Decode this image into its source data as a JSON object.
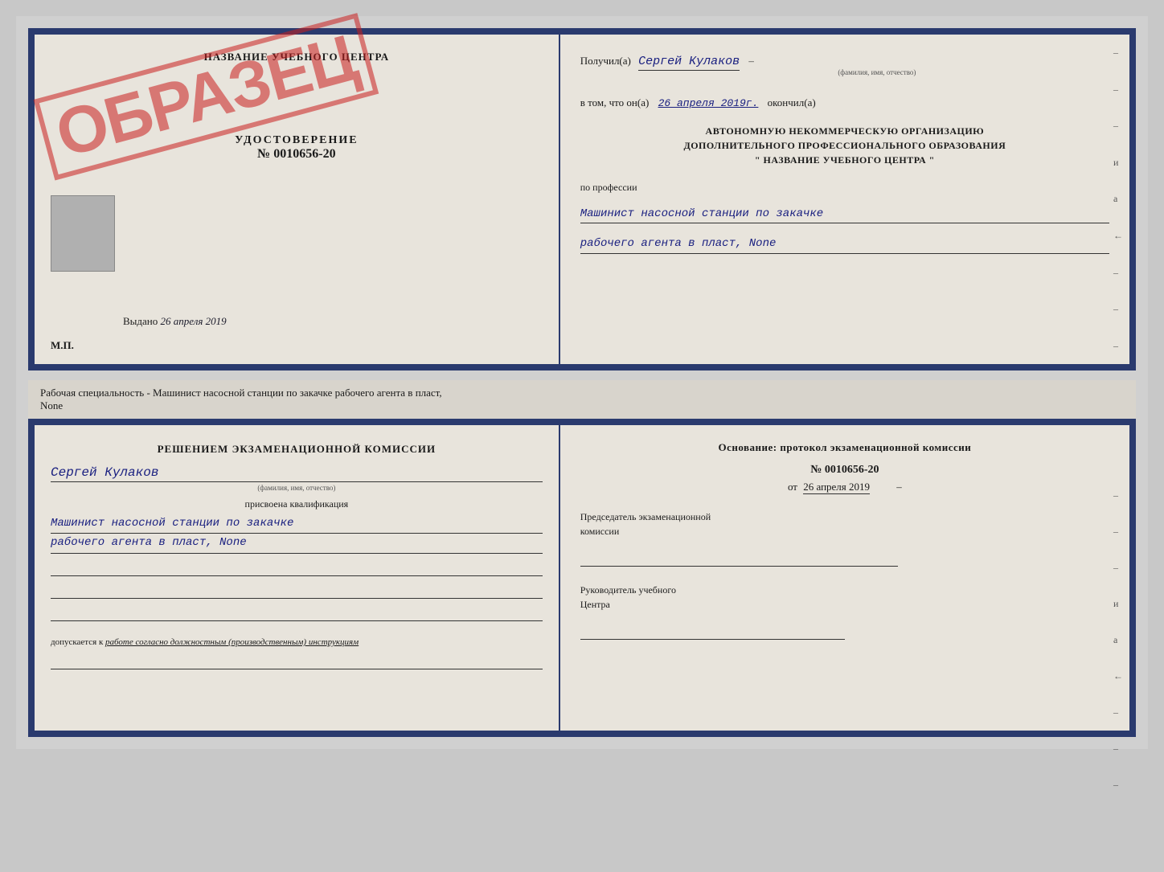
{
  "page": {
    "background": "#c8c8c8"
  },
  "top_doc": {
    "left": {
      "title": "НАЗВАНИЕ УЧЕБНОГО ЦЕНТРА",
      "stamp": "ОБРАЗЕЦ",
      "udostoverenie_label": "УДОСТОВЕРЕНИЕ",
      "number": "№ 0010656-20",
      "vydano_label": "Выдано",
      "vydano_date": "26 апреля 2019",
      "mp_label": "М.П."
    },
    "right": {
      "poluchil_prefix": "Получил(а)",
      "recipient_name": "Сергей Кулаков",
      "fio_hint": "(фамилия, имя, отчество)",
      "vtom_prefix": "в том, что он(а)",
      "date_value": "26 апреля 2019г.",
      "okonchil": "окончил(а)",
      "org_line1": "АВТОНОМНУЮ НЕКОММЕРЧЕСКУЮ ОРГАНИЗАЦИЮ",
      "org_line2": "ДОПОЛНИТЕЛЬНОГО ПРОФЕССИОНАЛЬНОГО ОБРАЗОВАНИЯ",
      "org_line3": "\"  НАЗВАНИЕ УЧЕБНОГО ЦЕНТРА  \"",
      "po_professii": "по профессии",
      "profession_line1": "Машинист насосной станции по закачке",
      "profession_line2": "рабочего агента в пласт, None",
      "dashes": [
        "-",
        "-",
        "-",
        "и",
        "а",
        "←",
        "-",
        "-",
        "-"
      ]
    }
  },
  "middle_info": {
    "text": "Рабочая специальность - Машинист насосной станции по закачке рабочего агента в пласт,",
    "text2": "None"
  },
  "bottom_doc": {
    "left": {
      "resheniem_line1": "Решением  экзаменационной  комиссии",
      "name_handwritten": "Сергей Кулаков",
      "fio_hint": "(фамилия, имя, отчество)",
      "prisvoena": "присвоена квалификация",
      "qualification_line1": "Машинист насосной станции по закачке",
      "qualification_line2": "рабочего агента в пласт, None",
      "dopuskaetsya_prefix": "допускается к",
      "dopuskaetsya_text": "работе согласно должностным (производственным) инструкциям"
    },
    "right": {
      "osnovanie_title": "Основание: протокол экзаменационной  комиссии",
      "protokol_number": "№ 0010656-20",
      "ot_prefix": "от",
      "ot_date": "26 апреля 2019",
      "predsedatel_line1": "Председатель экзаменационной",
      "predsedatel_line2": "комиссии",
      "rukovoditel_line1": "Руководитель учебного",
      "rukovoditel_line2": "Центра",
      "dashes": [
        "-",
        "-",
        "-",
        "и",
        "а",
        "←",
        "-",
        "-",
        "-"
      ]
    }
  }
}
